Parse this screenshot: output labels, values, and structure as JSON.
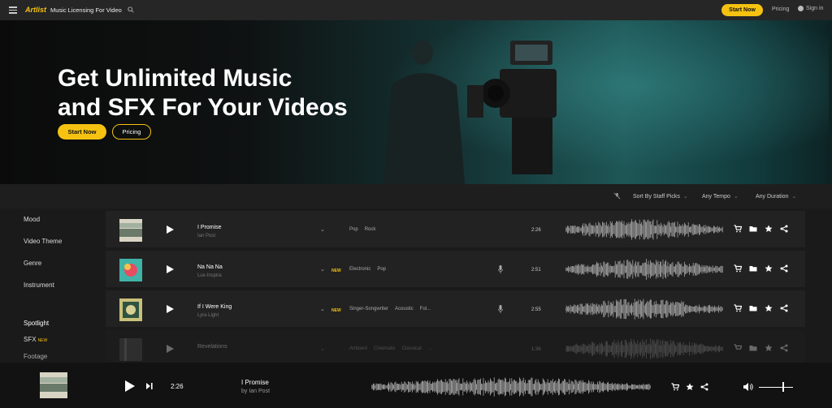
{
  "topbar": {
    "logo": "Artlist",
    "title": "Music Licensing For Video",
    "start_label": "Start Now",
    "pricing_label": "Pricing",
    "signin_label": "Sign in",
    "accent": "#f5c211"
  },
  "hero": {
    "headline_line1": "Get Unlimited Music",
    "headline_line2": "and SFX For Your Videos",
    "start_label": "Start Now",
    "pricing_label": "Pricing"
  },
  "filters": {
    "sort": "Sort By Staff Picks",
    "tempo": "Any Tempo",
    "duration": "Any Duration"
  },
  "sidebar": {
    "items": [
      "Mood",
      "Video Theme",
      "Genre",
      "Instrument"
    ],
    "spotlight": "Spotlight",
    "sfx": "SFX",
    "sfx_badge": "NEW",
    "footage": "Footage"
  },
  "tracks": [
    {
      "title": "I Promise",
      "artist": "Ian Post",
      "new": "",
      "tags": [
        "Pop",
        "Rock"
      ],
      "duration": "2:26",
      "vocal": false
    },
    {
      "title": "Na Na Na",
      "artist": "Lux-Inspira",
      "new": "NEW",
      "tags": [
        "Electronic",
        "Pop"
      ],
      "duration": "2:51",
      "vocal": true
    },
    {
      "title": "If I Were King",
      "artist": "Lyra Light",
      "new": "NEW",
      "tags": [
        "Singer-Songwriter",
        "Acoustic",
        "Fol..."
      ],
      "duration": "2:55",
      "vocal": true
    },
    {
      "title": "Revelations",
      "artist": "",
      "new": "",
      "tags": [
        "Ambient",
        "Cinematic",
        "Classical",
        "..."
      ],
      "duration": "1:36",
      "vocal": false
    }
  ],
  "player": {
    "time": "2:26",
    "title": "I Promise",
    "artist": "by Ian Post",
    "volume": 0.7
  }
}
